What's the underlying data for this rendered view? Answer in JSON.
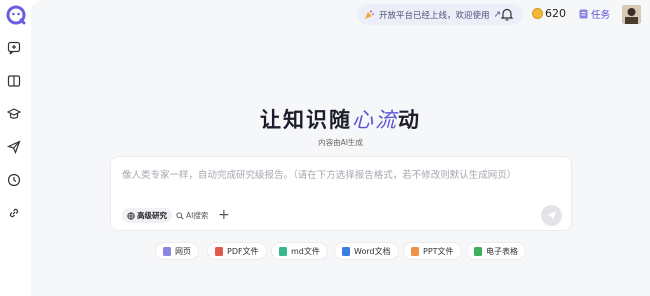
{
  "sidebar": {
    "logo": "robot-logo",
    "items": [
      {
        "name": "new-chat",
        "icon": "chat-plus-icon"
      },
      {
        "name": "library",
        "icon": "book-icon"
      },
      {
        "name": "learn",
        "icon": "graduation-cap-icon"
      },
      {
        "name": "send",
        "icon": "paper-plane-icon"
      },
      {
        "name": "history",
        "icon": "clock-icon"
      },
      {
        "name": "links",
        "icon": "link-icon"
      }
    ]
  },
  "topbar": {
    "announcement": "开放平台已经上线，欢迎使用",
    "coins": "620",
    "task_label": "任务"
  },
  "hero": {
    "title_prefix": "让知识随",
    "title_accent": "心流",
    "title_suffix": "动",
    "subtitle": "内容由AI生成"
  },
  "composer": {
    "placeholder": "像人类专家一样，自动完成研究级报告。（请在下方选择报告格式，若不修改则默认生成网页）",
    "mode_advanced": "高级研究",
    "mode_search": "AI搜索"
  },
  "formats": [
    {
      "label": "网页",
      "color": "#8b86e0"
    },
    {
      "label": "PDF文件",
      "color": "#e05a4e"
    },
    {
      "label": "md文件",
      "color": "#39b98a"
    },
    {
      "label": "Word文档",
      "color": "#3b7ee0"
    },
    {
      "label": "PPT文件",
      "color": "#f0934a"
    },
    {
      "label": "电子表格",
      "color": "#3fae5a"
    }
  ],
  "colors": {
    "accent": "#5c54d8",
    "background": "#f6f7f9"
  }
}
